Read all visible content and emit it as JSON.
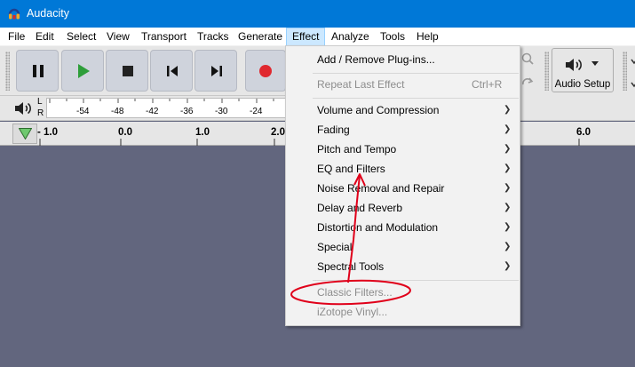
{
  "window": {
    "title": "Audacity"
  },
  "menubar": {
    "items": [
      "File",
      "Edit",
      "Select",
      "View",
      "Transport",
      "Tracks",
      "Generate",
      "Effect",
      "Analyze",
      "Tools",
      "Help"
    ],
    "active": "Effect"
  },
  "transport": {
    "buttons": [
      "pause-icon",
      "play-icon",
      "stop-icon",
      "skip-to-start-icon",
      "skip-to-end-icon",
      "record-icon"
    ],
    "play_color": "#2e9e3a",
    "record_color": "#e0282f"
  },
  "audio_setup": {
    "label": "Audio Setup"
  },
  "meter": {
    "channels": [
      "L",
      "R"
    ],
    "ticks": [
      "-54",
      "-48",
      "-42",
      "-36",
      "-30",
      "-24"
    ]
  },
  "timeline": {
    "labels": [
      "- 1.0",
      "0.0",
      "1.0",
      "2.0",
      "6.0"
    ]
  },
  "effect_menu": {
    "add_remove": "Add / Remove Plug-ins...",
    "repeat_last": "Repeat Last Effect",
    "repeat_shortcut": "Ctrl+R",
    "submenus": [
      "Volume and Compression",
      "Fading",
      "Pitch and Tempo",
      "EQ and Filters",
      "Noise Removal and Repair",
      "Delay and Reverb",
      "Distortion and Modulation",
      "Special",
      "Spectral Tools"
    ],
    "classic_filters": "Classic Filters...",
    "izotope_vinyl": "iZotope Vinyl..."
  },
  "annotation": {
    "color": "#e0001a"
  },
  "colors": {
    "titlebar": "#0078d7",
    "track_bg": "#62667e",
    "menu_bg": "#f2f2f2"
  }
}
